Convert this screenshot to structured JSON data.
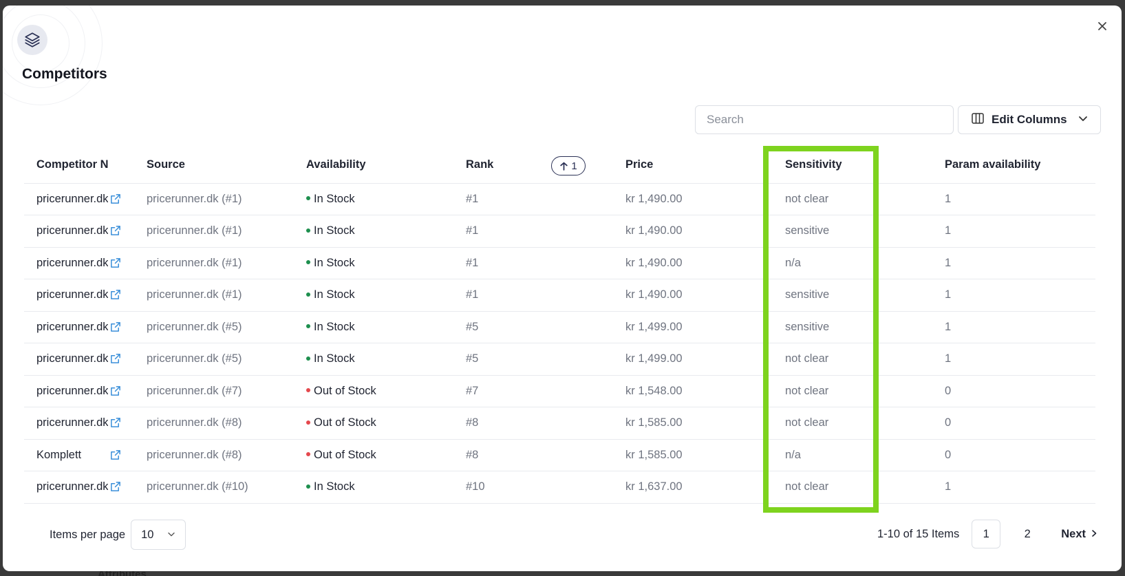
{
  "backdrop": {
    "partial_text": "Attributes"
  },
  "modal": {
    "title": "Competitors",
    "close_icon": "close-icon",
    "logo_icon": "layers-icon"
  },
  "toolbar": {
    "search_placeholder": "Search",
    "edit_columns_label": "Edit Columns"
  },
  "table": {
    "headers": {
      "competitor": "Competitor N",
      "source": "Source",
      "availability": "Availability",
      "rank": "Rank",
      "rank_sort_value": "1",
      "price": "Price",
      "sensitivity": "Sensitivity",
      "param_availability": "Param availability"
    },
    "rows": [
      {
        "competitor": "pricerunner.dk",
        "source": "pricerunner.dk (#1)",
        "availability": "In Stock",
        "rank": "#1",
        "price": "kr 1,490.00",
        "sensitivity": "not clear",
        "param_availability": "1"
      },
      {
        "competitor": "pricerunner.dk",
        "source": "pricerunner.dk (#1)",
        "availability": "In Stock",
        "rank": "#1",
        "price": "kr 1,490.00",
        "sensitivity": "sensitive",
        "param_availability": "1"
      },
      {
        "competitor": "pricerunner.dk",
        "source": "pricerunner.dk (#1)",
        "availability": "In Stock",
        "rank": "#1",
        "price": "kr 1,490.00",
        "sensitivity": "n/a",
        "param_availability": "1"
      },
      {
        "competitor": "pricerunner.dk",
        "source": "pricerunner.dk (#1)",
        "availability": "In Stock",
        "rank": "#1",
        "price": "kr 1,490.00",
        "sensitivity": "sensitive",
        "param_availability": "1"
      },
      {
        "competitor": "pricerunner.dk",
        "source": "pricerunner.dk (#5)",
        "availability": "In Stock",
        "rank": "#5",
        "price": "kr 1,499.00",
        "sensitivity": "sensitive",
        "param_availability": "1"
      },
      {
        "competitor": "pricerunner.dk",
        "source": "pricerunner.dk (#5)",
        "availability": "In Stock",
        "rank": "#5",
        "price": "kr 1,499.00",
        "sensitivity": "not clear",
        "param_availability": "1"
      },
      {
        "competitor": "pricerunner.dk",
        "source": "pricerunner.dk (#7)",
        "availability": "Out of Stock",
        "rank": "#7",
        "price": "kr 1,548.00",
        "sensitivity": "not clear",
        "param_availability": "0"
      },
      {
        "competitor": "pricerunner.dk",
        "source": "pricerunner.dk (#8)",
        "availability": "Out of Stock",
        "rank": "#8",
        "price": "kr 1,585.00",
        "sensitivity": "not clear",
        "param_availability": "0"
      },
      {
        "competitor": "Komplett",
        "source": "pricerunner.dk (#8)",
        "availability": "Out of Stock",
        "rank": "#8",
        "price": "kr 1,585.00",
        "sensitivity": "n/a",
        "param_availability": "0"
      },
      {
        "competitor": "pricerunner.dk",
        "source": "pricerunner.dk (#10)",
        "availability": "In Stock",
        "rank": "#10",
        "price": "kr 1,637.00",
        "sensitivity": "not clear",
        "param_availability": "1"
      }
    ]
  },
  "pagination": {
    "items_per_page_label": "Items per page",
    "items_per_page_value": "10",
    "range_text": "1-10 of 15 Items",
    "pages": [
      "1",
      "2"
    ],
    "active_page": "1",
    "next_label": "Next"
  },
  "colors": {
    "in_stock": "#1e8f4e",
    "out_of_stock": "#e5484d",
    "link_icon": "#3a8fd9",
    "highlight": "#7ed31e",
    "sort_badge": "#2b3155"
  }
}
